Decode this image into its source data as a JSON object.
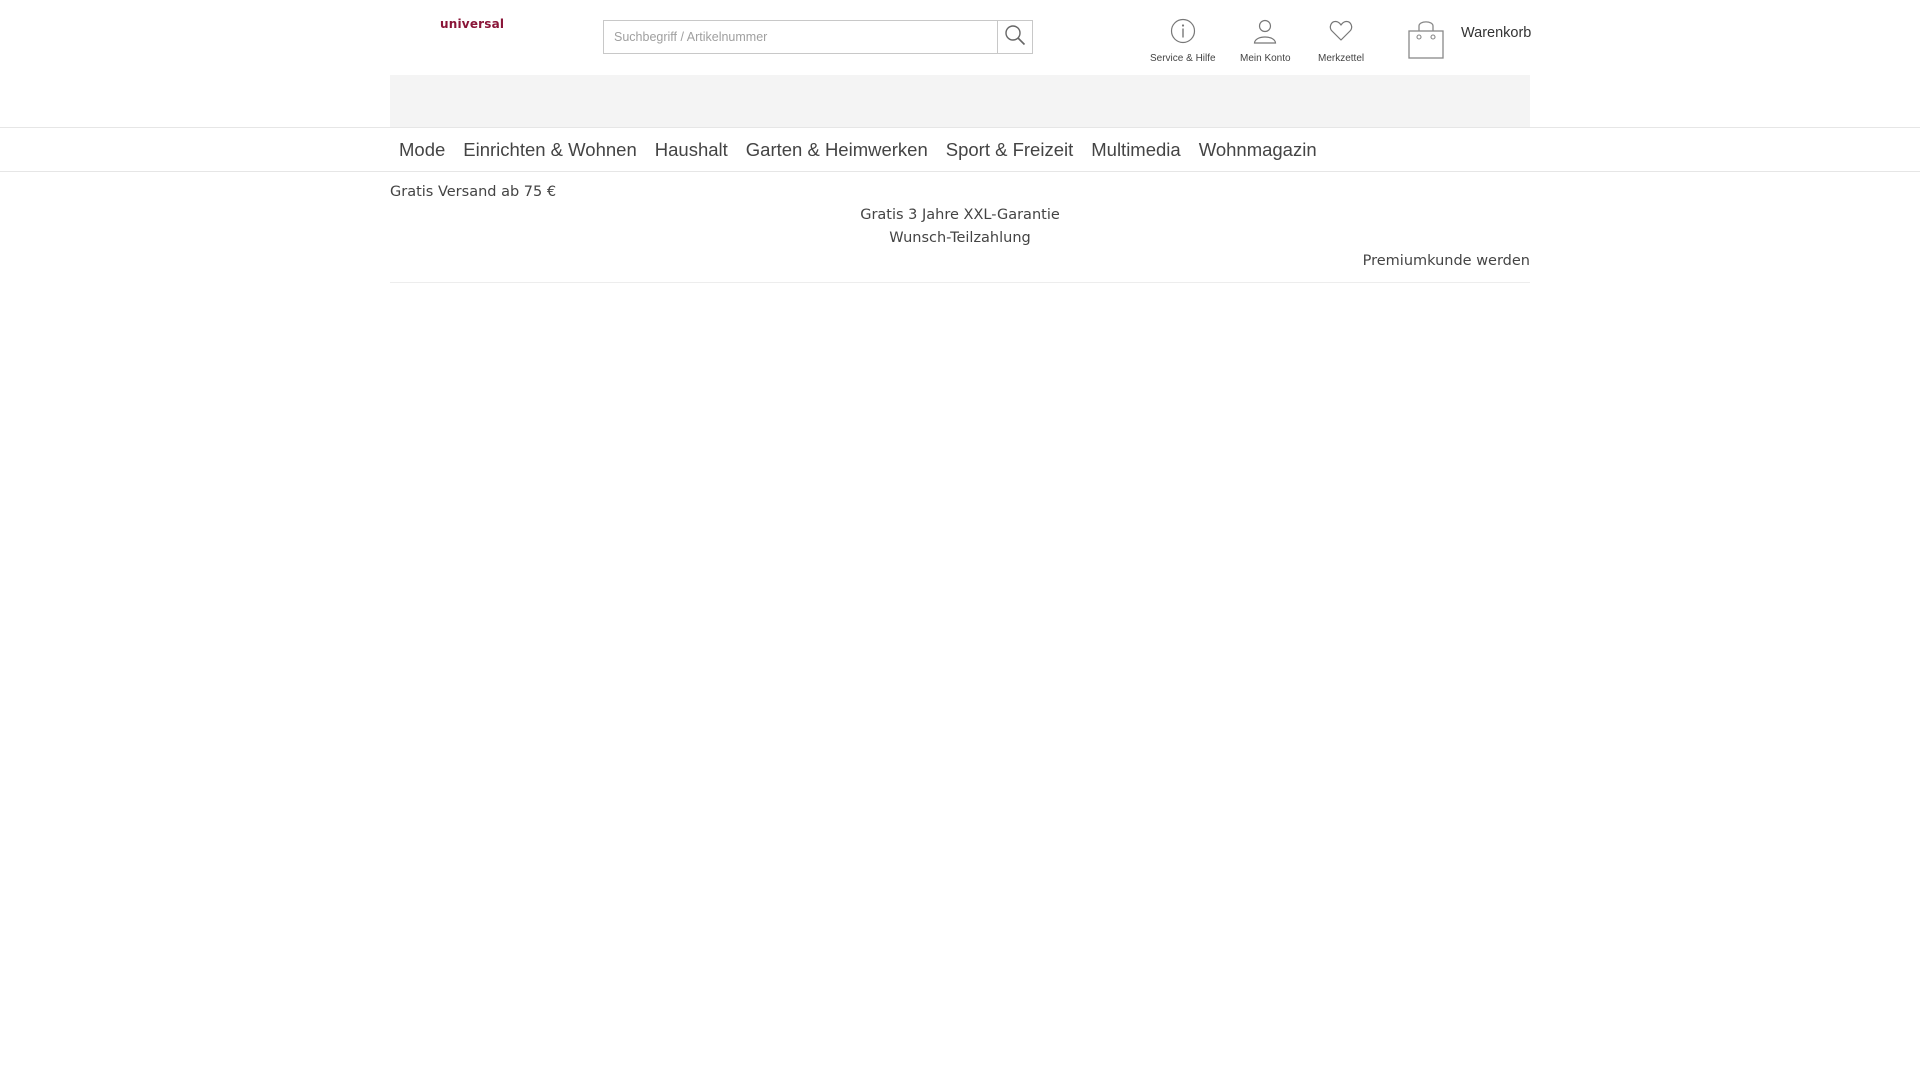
{
  "header": {
    "logo_text": "universal",
    "brand_color": "#8a1538",
    "search": {
      "placeholder": "Suchbegriff / Artikelnummer",
      "value": "",
      "icon": "search-icon"
    },
    "service": {
      "label": "Service & Hilfe",
      "icon": "info-icon"
    },
    "account": {
      "label": "Mein Konto",
      "icon": "user-icon"
    },
    "wishlist": {
      "label": "Merkzettel",
      "icon": "heart-icon"
    },
    "cart": {
      "label": "Warenkorb",
      "icon": "shopping-bag-icon"
    }
  },
  "nav": {
    "items": [
      {
        "label": "Mode"
      },
      {
        "label": "Einrichten & Wohnen"
      },
      {
        "label": "Haushalt"
      },
      {
        "label": "Garten & Heimwerken"
      },
      {
        "label": "Sport & Freizeit"
      },
      {
        "label": "Multimedia"
      },
      {
        "label": "Wohnmagazin"
      }
    ]
  },
  "usp": {
    "shipping": "Gratis Versand ab 75 €",
    "warranty": "Gratis 3 Jahre XXL-Garantie",
    "installment": "Wunsch-Teilzahlung",
    "premium": "Premiumkunde werden"
  }
}
